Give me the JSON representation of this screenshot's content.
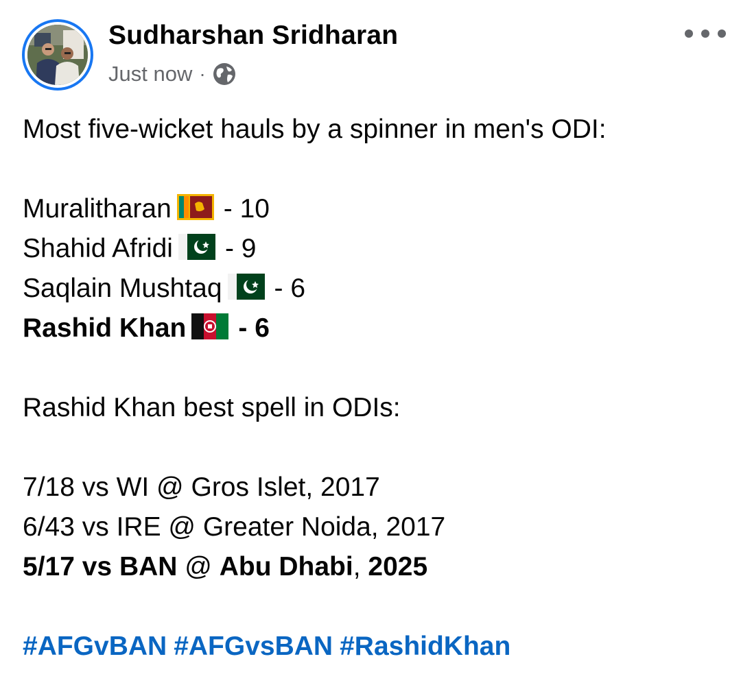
{
  "post": {
    "author_name": "Sudharshan Sridharan",
    "timestamp": "Just now",
    "separator": "·",
    "privacy_icon": "globe-icon",
    "more_icon": "more-options-icon"
  },
  "content": {
    "intro": "Most five-wicket hauls by a spinner in men's ODI:",
    "rankings": [
      {
        "name": "Muralitharan",
        "flag": "sri-lanka-flag-icon",
        "value": "- 10",
        "bold": false
      },
      {
        "name": "Shahid Afridi",
        "flag": "pakistan-flag-icon",
        "value": "- 9",
        "bold": false
      },
      {
        "name": "Saqlain Mushtaq",
        "flag": "pakistan-flag-icon",
        "value": "- 6",
        "bold": false
      },
      {
        "name": "Rashid Khan",
        "flag": "afghanistan-flag-icon",
        "value": "- 6",
        "bold": true
      }
    ],
    "spells_heading": "Rashid Khan best spell in ODIs:",
    "spells": [
      {
        "text": "7/18 vs WI @ Gros Islet, 2017",
        "bold": false
      },
      {
        "text": "6/43 vs IRE @ Greater Noida, 2017",
        "bold": false
      }
    ],
    "spell_bold": {
      "a": "5/17 vs BAN",
      "b": " @ ",
      "c": "Abu Dhabi",
      "d": ", ",
      "e": "2025"
    },
    "hashtags": [
      "#AFGvBAN",
      "#AFGvsBAN",
      "#RashidKhan"
    ]
  },
  "colors": {
    "accent": "#1877f2",
    "hashtag": "#0a66c2",
    "muted": "#65676b",
    "text": "#050505"
  }
}
